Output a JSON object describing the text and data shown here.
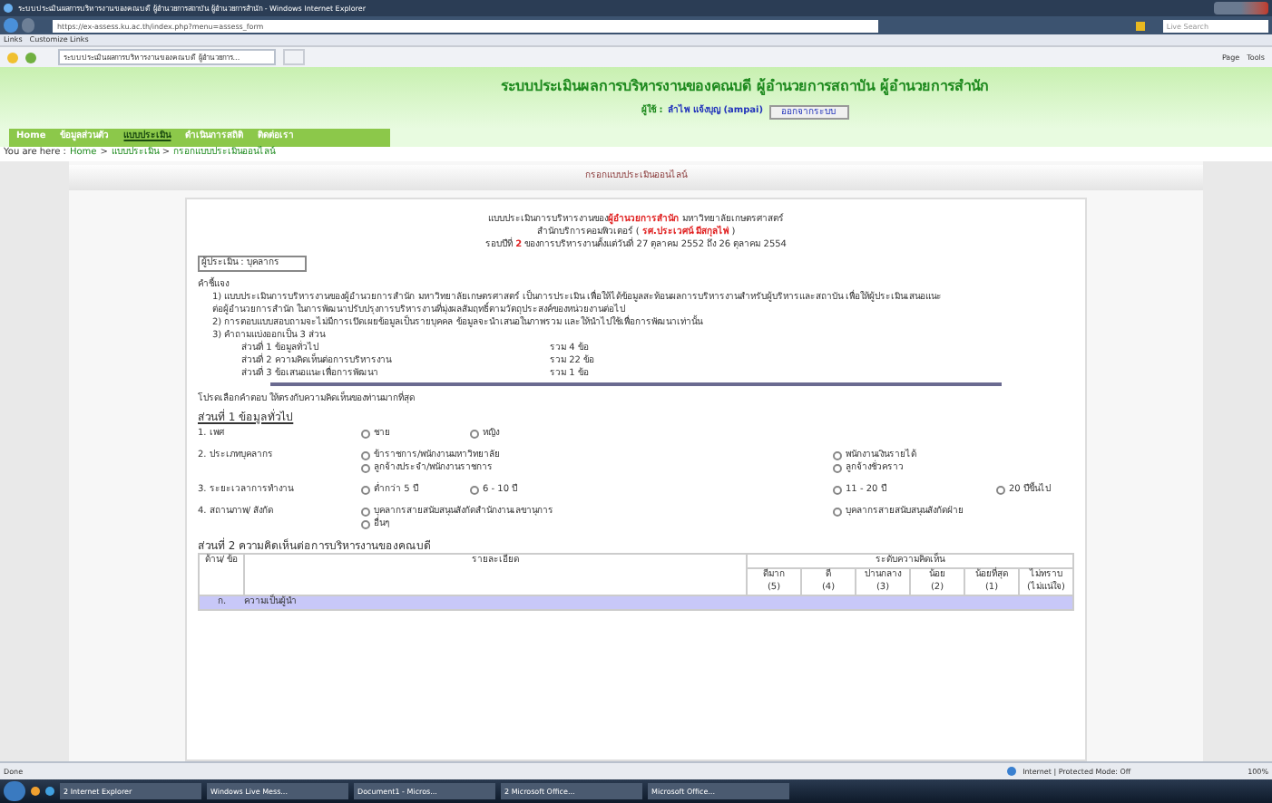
{
  "browser": {
    "title": "ระบบประเมินผลการบริหารงานของคณบดี ผู้อำนวยการสถาบัน ผู้อำนวยการสำนัก - Windows Internet Explorer",
    "address": "https://ex-assess.ku.ac.th/index.php?menu=assess_form",
    "search_placeholder": "Live Search",
    "links_label": "Links",
    "links_item": "Customize Links",
    "tab_title": "ระบบประเมินผลการบริหารงานของคณบดี ผู้อำนวยการ...",
    "commands": [
      "Page",
      "Tools"
    ]
  },
  "header": {
    "title": "ระบบประเมินผลการบริหารงานของคณบดี ผู้อำนวยการสถาบัน ผู้อำนวยการสำนัก",
    "user_label": "ผู้ใช้ :",
    "user_name": "ลำไพ แจ้งบุญ (ampai)",
    "logout": "ออกจากระบบ"
  },
  "menu": [
    {
      "label": "Home",
      "selected": false
    },
    {
      "label": "ข้อมูลส่วนตัว",
      "selected": false
    },
    {
      "label": "แบบประเมิน",
      "selected": true
    },
    {
      "label": "ดำเนินการสถิติ",
      "selected": false
    },
    {
      "label": "ติดต่อเรา",
      "selected": false
    }
  ],
  "breadcrumb": {
    "prefix": "You are here :",
    "separator": ">",
    "items": [
      "Home",
      "แบบประเมิน",
      "กรอกแบบประเมินออนไลน์"
    ]
  },
  "panel_title": "กรอกแบบประเมินออนไลน์",
  "form": {
    "heading": [
      "แบบประเมินการบริหารงานของ**ผู้อำนวยการสำนัก** มหาวิทยาลัยเกษตรศาสตร์",
      "สำนักบริการคอมพิวเตอร์ ( **รศ.ประเวศน์ มีสกุลไพ่** )",
      "รอบปีที่ **2** ของการบริหารงานตั้งแต่วันที่ 27 ตุลาคม 2552 ถึง 26 ตุลาคม 2554"
    ],
    "evaluator": "ผู้ประเมิน : บุคลากร",
    "instructions_title": "คำชี้แจง",
    "instructions": [
      "1) แบบประเมินการบริหารงานของผู้อำนวยการสำนัก มหาวิทยาลัยเกษตรศาสตร์ เป็นการประเมิน เพื่อให้ได้ข้อมูลสะท้อนผลการบริหารงานสำหรับผู้บริหารและสถาบัน เพื่อให้ผู้ประเมินเสนอแนะ",
      "ต่อผู้อำนวยการสำนัก ในการพัฒนาปรับปรุงการบริหารงานที่มุ่งผลสัมฤทธิ์ตามวัตถุประสงค์ของหน่วยงานต่อไป",
      "2) การตอบแบบสอบถามจะไม่มีการเปิดเผยข้อมูลเป็นรายบุคคล ข้อมูลจะนำเสนอในภาพรวม และให้นำไปใช้เพื่อการพัฒนาเท่านั้น",
      "3) คำถามแบ่งออกเป็น 3 ส่วน"
    ],
    "parts": [
      {
        "name": "ส่วนที่ 1 ข้อมูลทั่วไป",
        "count": "รวม 4 ข้อ"
      },
      {
        "name": "ส่วนที่ 2 ความคิดเห็นต่อการบริหารงาน",
        "count": "รวม 22 ข้อ"
      },
      {
        "name": "ส่วนที่ 3 ข้อเสนอแนะเพื่อการพัฒนา",
        "count": "รวม 1 ข้อ"
      }
    ],
    "prompt": "โปรดเลือกคำตอบ ให้ตรงกับความคิดเห็นของท่านมากที่สุด",
    "section1_title": "ส่วนที่ 1 ข้อมูลทั่วไป",
    "questions": [
      {
        "label": "1. เพศ",
        "kind": "short",
        "rows": [
          [
            {
              "label": "ชาย",
              "selected": false
            },
            {
              "label": "หญิง",
              "selected": false
            }
          ]
        ]
      },
      {
        "label": "2. ประเภทบุคลากร",
        "kind": "long",
        "rows": [
          [
            {
              "label": "ข้าราชการ/พนักงานมหาวิทยาลัย",
              "selected": false
            },
            {
              "label": "พนักงานเงินรายได้",
              "selected": false
            }
          ],
          [
            {
              "label": "ลูกจ้างประจำ/พนักงานราชการ",
              "selected": false
            },
            {
              "label": "ลูกจ้างชั่วคราว",
              "selected": false
            }
          ]
        ]
      },
      {
        "label": "3. ระยะเวลาการทำงาน",
        "kind": "range",
        "rows": [
          [
            {
              "label": "ต่ำกว่า 5 ปี",
              "selected": false
            },
            {
              "label": "6 - 10 ปี",
              "selected": false
            },
            {
              "label": "11 - 20 ปี",
              "selected": false
            },
            {
              "label": "20 ปีขึ้นไป",
              "selected": false
            }
          ]
        ]
      },
      {
        "label": "4. สถานภาพ/ สังกัด",
        "kind": "long",
        "rows": [
          [
            {
              "label": "บุคลากรสายสนับสนุนสังกัดสำนักงานเลขานุการ",
              "selected": false
            },
            {
              "label": "บุคลากรสายสนับสนุนสังกัดฝ่าย",
              "selected": false
            }
          ],
          [
            {
              "label": "อื่นๆ",
              "selected": false
            }
          ]
        ]
      }
    ],
    "section2_title": "ส่วนที่ 2 ความคิดเห็นต่อการบริหารงานของคณบดี",
    "table": {
      "col_item": "ด้าน/ ข้อ",
      "col_detail": "รายละเอียด",
      "col_level": "ระดับความคิดเห็น",
      "levels": [
        [
          "ดีมาก",
          "(5)"
        ],
        [
          "ดี",
          "(4)"
        ],
        [
          "ปานกลาง",
          "(3)"
        ],
        [
          "น้อย",
          "(2)"
        ],
        [
          "น้อยที่สุด",
          "(1)"
        ],
        [
          "ไม่ทราบ",
          "(ไม่แน่ใจ)"
        ]
      ],
      "group_row": {
        "code": "ก.",
        "label": "ความเป็นผู้นำ"
      }
    }
  },
  "status_bar": {
    "text": "Done",
    "zone": "Internet | Protected Mode: Off",
    "zoom": "100%"
  },
  "taskbar": {
    "items": [
      "2 Internet Explorer",
      "Windows Live Mess...",
      "Document1 - Micros...",
      "2 Microsoft Office...",
      "Microsoft Office..."
    ]
  }
}
